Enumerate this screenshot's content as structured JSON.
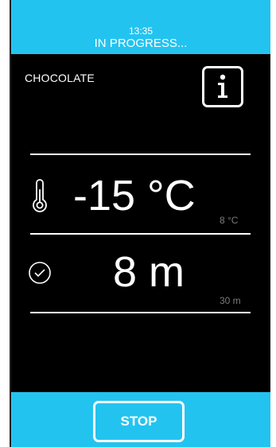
{
  "header": {
    "time": "13:35",
    "status": "IN PROGRESS..."
  },
  "program": {
    "name": "CHOCOLATE"
  },
  "info_button": {
    "label": "i",
    "icon": "info-icon"
  },
  "temperature": {
    "value": "-15 °C",
    "target": "8 °C",
    "icon": "thermometer-icon"
  },
  "duration": {
    "value": "8 m",
    "target": "30 m",
    "icon": "clock-icon"
  },
  "footer": {
    "stop_label": "STOP"
  },
  "colors": {
    "accent": "#23c3f0",
    "background": "#000000",
    "text": "#ffffff",
    "muted": "#7a7a7a"
  }
}
